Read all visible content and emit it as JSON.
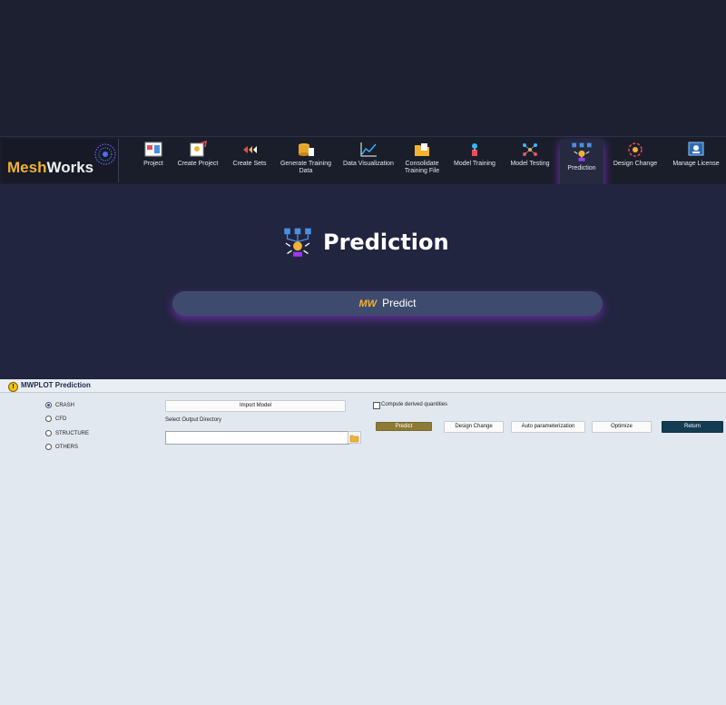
{
  "app": {
    "brand_mesh": "Mesh",
    "brand_works": "Works"
  },
  "ribbon": {
    "items": [
      {
        "label": "Project",
        "icon": "project-icon"
      },
      {
        "label": "Create Project",
        "icon": "create-project-icon"
      },
      {
        "label": "Create Sets",
        "icon": "create-sets-icon"
      },
      {
        "label": "Generate Training Data",
        "icon": "generate-training-data-icon"
      },
      {
        "label": "Data Visualization",
        "icon": "data-visualization-icon"
      },
      {
        "label": "Consolidate Training File",
        "icon": "consolidate-training-file-icon"
      },
      {
        "label": "Model Training",
        "icon": "model-training-icon"
      },
      {
        "label": "Model Testing",
        "icon": "model-testing-icon"
      },
      {
        "label": "Prediction",
        "icon": "prediction-icon",
        "active": true
      },
      {
        "label": "Design Change",
        "icon": "design-change-icon"
      },
      {
        "label": "Manage License",
        "icon": "manage-license-icon"
      }
    ]
  },
  "main": {
    "title": "Prediction",
    "predict_button": {
      "logo": "MW",
      "label": "Predict"
    }
  },
  "mwplot": {
    "title": "MWPLOT Prediction",
    "options": [
      {
        "label": "CRASH",
        "selected": true
      },
      {
        "label": "CFD",
        "selected": false
      },
      {
        "label": "STRUCTURE",
        "selected": false
      },
      {
        "label": "OTHERS",
        "selected": false
      }
    ],
    "import_model_label": "Import Model",
    "output_dir_label": "Select Output Directory",
    "output_dir_value": "",
    "compute_derived_label": "Compute derived quantities",
    "compute_derived_checked": false,
    "buttons": {
      "predict": "Predict",
      "design_change": "Design Change",
      "auto_param": "Auto parameterization",
      "optimize": "Optimize",
      "return": "Return"
    }
  },
  "colors": {
    "accent_purple": "#9b39ff",
    "brand_gold": "#f2b233",
    "predict_btn": "#8d7b35",
    "return_btn": "#143c53"
  }
}
